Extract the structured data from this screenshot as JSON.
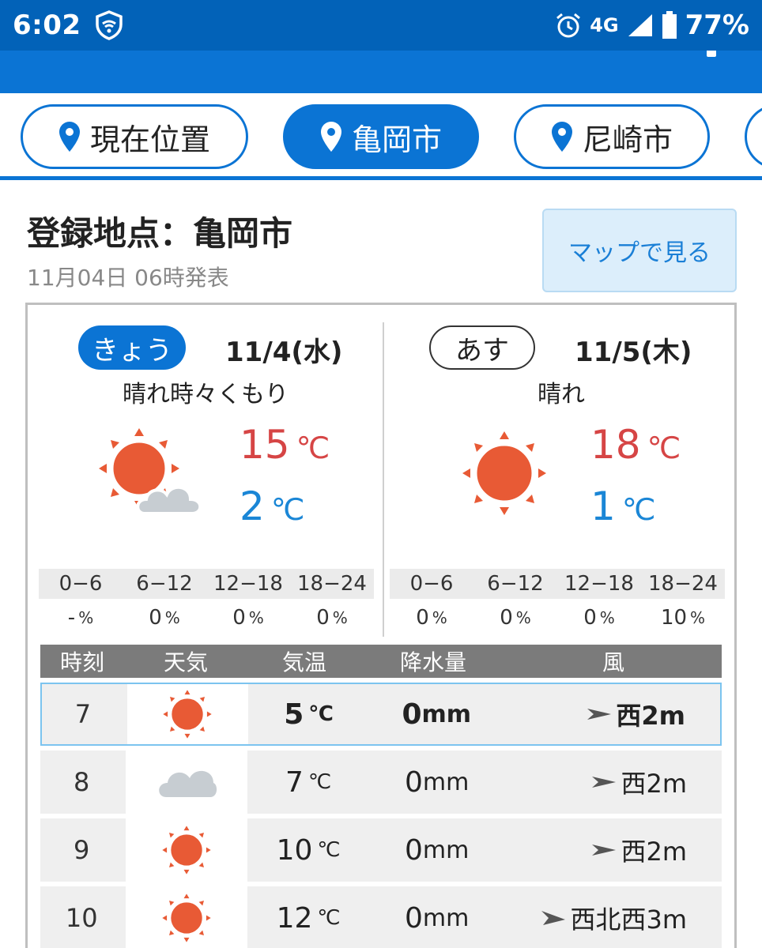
{
  "status_bar": {
    "time": "6:02",
    "network": "4G",
    "battery": "77%",
    "icons": [
      "shield-icon",
      "alarm-icon",
      "signal-icon",
      "battery-icon"
    ]
  },
  "tabs": [
    {
      "label": "現在位置",
      "active": false
    },
    {
      "label": "亀岡市",
      "active": true
    },
    {
      "label": "尼崎市",
      "active": false
    }
  ],
  "header": {
    "title": "登録地点：亀岡市",
    "issued": "11月04日 06時発表",
    "map_button": "マップで見る"
  },
  "today": {
    "pill": "きょう",
    "date": "11/4(水)",
    "condition": "晴れ時々くもり",
    "icon": "sun-cloud-icon",
    "high": "15",
    "low": "2",
    "unit": "℃",
    "periods": [
      "0−6",
      "6−12",
      "12−18",
      "18−24"
    ],
    "precip": [
      "-",
      "0",
      "0",
      "0"
    ]
  },
  "tomorrow": {
    "pill": "あす",
    "date": "11/5(木)",
    "condition": "晴れ",
    "icon": "sun-icon",
    "high": "18",
    "low": "1",
    "unit": "℃",
    "periods": [
      "0−6",
      "6−12",
      "12−18",
      "18−24"
    ],
    "precip": [
      "0",
      "0",
      "0",
      "10"
    ]
  },
  "percent_sign": "%",
  "hourly": {
    "headers": {
      "time": "時刻",
      "weather": "天気",
      "temp": "気温",
      "rain": "降水量",
      "wind": "風"
    },
    "temp_unit": "℃",
    "rain_unit": "mm",
    "rows": [
      {
        "hour": "7",
        "icon": "sun-icon",
        "temp": "5",
        "rain": "0",
        "wind": "西2m"
      },
      {
        "hour": "8",
        "icon": "cloud-icon",
        "temp": "7",
        "rain": "0",
        "wind": "西2m"
      },
      {
        "hour": "9",
        "icon": "sun-icon",
        "temp": "10",
        "rain": "0",
        "wind": "西2m"
      },
      {
        "hour": "10",
        "icon": "sun-icon",
        "temp": "12",
        "rain": "0",
        "wind": "西北西3m"
      }
    ]
  },
  "colors": {
    "primary": "#0b74d4",
    "statusbar": "#0262b8",
    "high_temp": "#d64545",
    "low_temp": "#1a86d6",
    "sun": "#e85a35"
  }
}
